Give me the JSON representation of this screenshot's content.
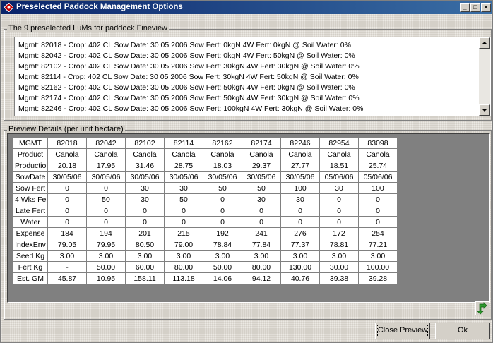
{
  "window": {
    "title": "Preselected Paddock Management Options",
    "btn_min": "_",
    "btn_max": "□",
    "btn_close": "×"
  },
  "luma_group": {
    "label": "The 9 preselected LuMs for paddock Fineview",
    "items": [
      "Mgmt: 82018 - Crop: 402 CL Sow Date: 30 05 2006 Sow Fert: 0kgN 4W Fert: 0kgN @ Soil Water: 0%",
      "Mgmt: 82042 - Crop: 402 CL Sow Date: 30 05 2006 Sow Fert: 0kgN 4W Fert: 50kgN @ Soil Water: 0%",
      "Mgmt: 82102 - Crop: 402 CL Sow Date: 30 05 2006 Sow Fert: 30kgN 4W Fert: 30kgN @ Soil Water: 0%",
      "Mgmt: 82114 - Crop: 402 CL Sow Date: 30 05 2006 Sow Fert: 30kgN 4W Fert: 50kgN @ Soil Water: 0%",
      "Mgmt: 82162 - Crop: 402 CL Sow Date: 30 05 2006 Sow Fert: 50kgN 4W Fert: 0kgN @ Soil Water: 0%",
      "Mgmt: 82174 - Crop: 402 CL Sow Date: 30 05 2006 Sow Fert: 50kgN 4W Fert: 30kgN @ Soil Water: 0%",
      "Mgmt: 82246 - Crop: 402 CL Sow Date: 30 05 2006 Sow Fert: 100kgN 4W Fert: 30kgN @ Soil Water: 0%"
    ]
  },
  "preview": {
    "label": "Preview Details (per unit hectare)",
    "rows": [
      [
        "MGMT",
        "82018",
        "82042",
        "82102",
        "82114",
        "82162",
        "82174",
        "82246",
        "82954",
        "83098"
      ],
      [
        "Product",
        "Canola",
        "Canola",
        "Canola",
        "Canola",
        "Canola",
        "Canola",
        "Canola",
        "Canola",
        "Canola"
      ],
      [
        "Production",
        "20.18",
        "17.95",
        "31.46",
        "28.75",
        "18.03",
        "29.37",
        "27.77",
        "18.51",
        "25.74"
      ],
      [
        "SowDate",
        "30/05/06",
        "30/05/06",
        "30/05/06",
        "30/05/06",
        "30/05/06",
        "30/05/06",
        "30/05/06",
        "05/06/06",
        "05/06/06"
      ],
      [
        "Sow Fert",
        "0",
        "0",
        "30",
        "30",
        "50",
        "50",
        "100",
        "30",
        "100"
      ],
      [
        "4 Wks Fert",
        "0",
        "50",
        "30",
        "50",
        "0",
        "30",
        "30",
        "0",
        "0"
      ],
      [
        "Late Fert",
        "0",
        "0",
        "0",
        "0",
        "0",
        "0",
        "0",
        "0",
        "0"
      ],
      [
        "Water",
        "0",
        "0",
        "0",
        "0",
        "0",
        "0",
        "0",
        "0",
        "0"
      ],
      [
        "Expense",
        "184",
        "194",
        "201",
        "215",
        "192",
        "241",
        "276",
        "172",
        "254"
      ],
      [
        "IndexEnv",
        "79.05",
        "79.95",
        "80.50",
        "79.00",
        "78.84",
        "77.84",
        "77.37",
        "78.81",
        "77.21"
      ],
      [
        "Seed Kg",
        "3.00",
        "3.00",
        "3.00",
        "3.00",
        "3.00",
        "3.00",
        "3.00",
        "3.00",
        "3.00"
      ],
      [
        "Fert Kg",
        "-",
        "50.00",
        "60.00",
        "80.00",
        "50.00",
        "80.00",
        "130.00",
        "30.00",
        "100.00"
      ],
      [
        "Est. GM",
        "45.87",
        "10.95",
        "158.11",
        "113.18",
        "14.06",
        "94.12",
        "40.76",
        "39.38",
        "39.28"
      ]
    ]
  },
  "buttons": {
    "close_preview": "Close Preview",
    "ok": "Ok"
  },
  "colors": {
    "titlebar_start": "#0a246a",
    "titlebar_end": "#3a6ea5",
    "refresh_icon": "#2e9a2e"
  },
  "icons": {
    "title": "paddock-app-icon",
    "refresh": "green-refresh-arrow-icon"
  }
}
